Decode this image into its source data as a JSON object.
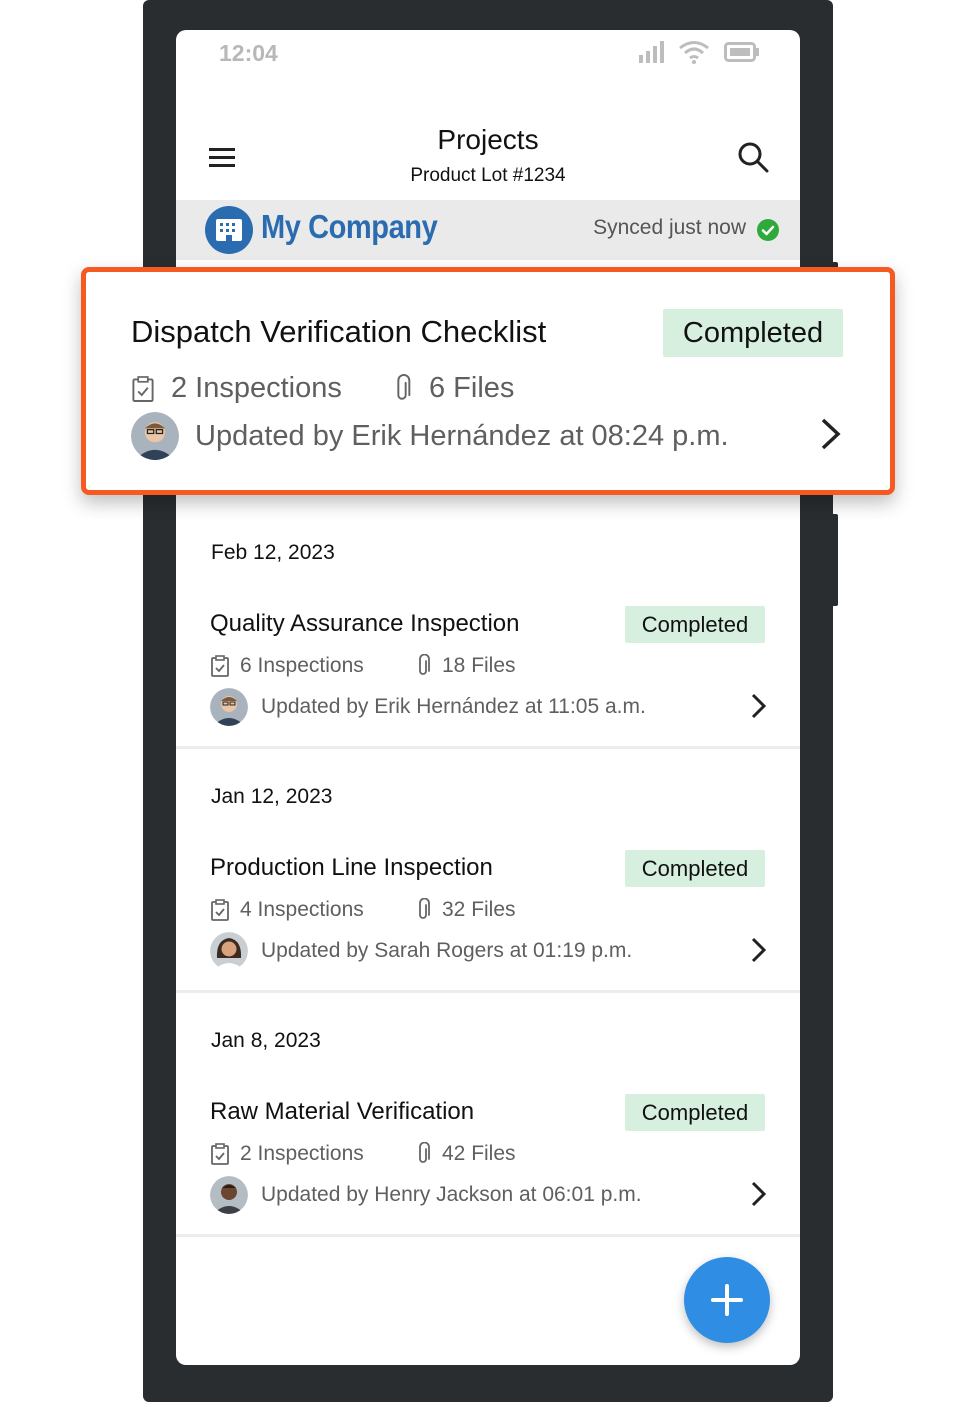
{
  "status_bar": {
    "time": "12:04"
  },
  "header": {
    "title": "Projects",
    "subtitle": "Product Lot #1234"
  },
  "company_bar": {
    "name": "My Company",
    "sync_text": "Synced just now"
  },
  "highlighted_item": {
    "title": "Dispatch Verification Checklist",
    "status": "Completed",
    "inspections": "2 Inspections",
    "files": "6 Files",
    "updated": "Updated by Erik Hernández at 08:24 p.m."
  },
  "entries": [
    {
      "date": "Feb 12, 2023",
      "title": "Quality Assurance Inspection",
      "status": "Completed",
      "inspections": "6 Inspections",
      "files": "18 Files",
      "updated": "Updated by Erik Hernández at 11:05 a.m."
    },
    {
      "date": "Jan 12, 2023",
      "title": "Production Line Inspection",
      "status": "Completed",
      "inspections": "4 Inspections",
      "files": "32 Files",
      "updated": "Updated by Sarah Rogers at 01:19 p.m."
    },
    {
      "date": "Jan 8, 2023",
      "title": "Raw Material Verification",
      "status": "Completed",
      "inspections": "2 Inspections",
      "files": "42 Files",
      "updated": "Updated by Henry Jackson at 06:01 p.m."
    }
  ],
  "colors": {
    "accent": "#2b6cb0",
    "highlight_border": "#f45a22",
    "badge_bg": "#d6efdf",
    "fab": "#2f8de4",
    "synced": "#2eaa3c"
  },
  "icons": [
    "signal-icon",
    "wifi-icon",
    "battery-icon",
    "menu-icon",
    "search-icon",
    "building-icon",
    "check-circle-icon",
    "clipboard-icon",
    "paperclip-icon",
    "chevron-right-icon",
    "plus-icon"
  ]
}
